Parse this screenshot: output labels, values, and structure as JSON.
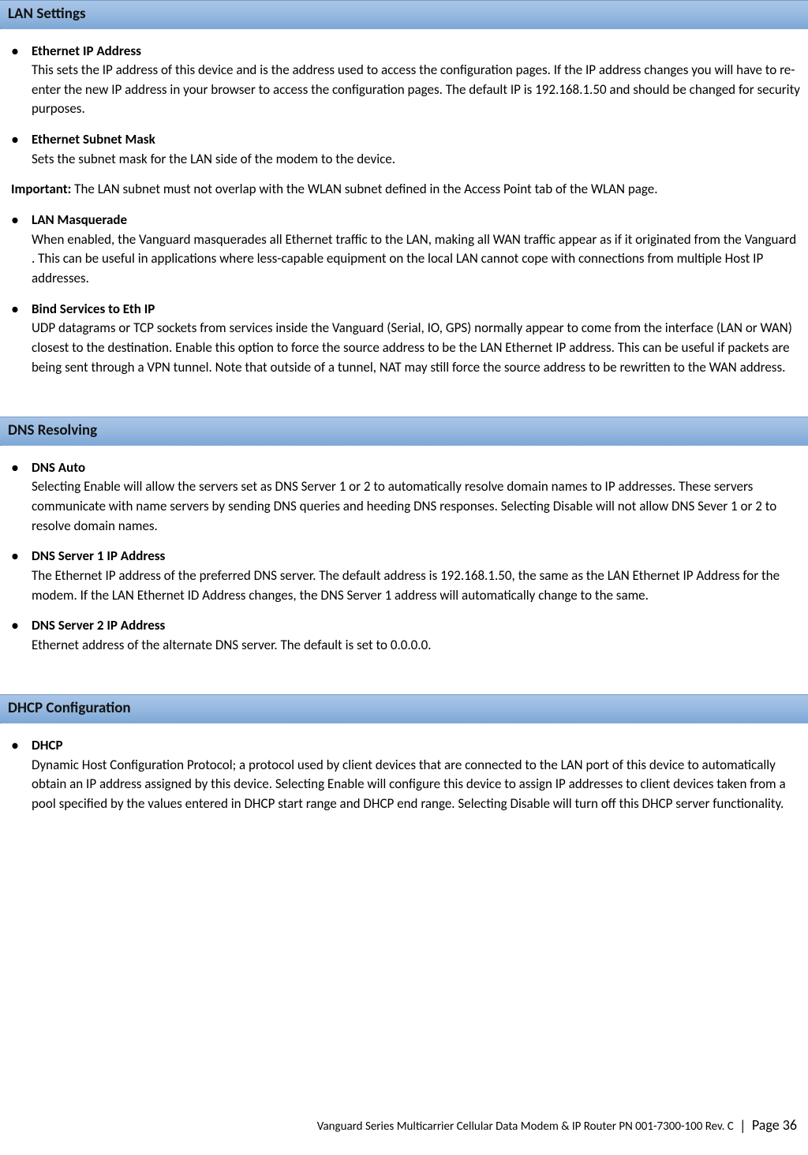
{
  "sections": [
    {
      "title": "LAN Settings",
      "items_before": [
        {
          "title": "Ethernet IP Address",
          "desc": "This sets the IP address of this device and is the address used to access the configuration pages. If the IP address changes you will have to re-enter the new IP address in your browser to access the configuration pages. The default IP is 192.168.1.50 and should be changed for security purposes."
        },
        {
          "title": "Ethernet Subnet Mask",
          "desc": "Sets the subnet mask for the LAN side of the modem to the device."
        }
      ],
      "note": {
        "label": "Important:",
        "text": " The LAN subnet must not overlap with the WLAN subnet defined in the Access Point tab of the WLAN page."
      },
      "items_after": [
        {
          "title": "LAN Masquerade",
          "desc": "When enabled, the Vanguard masquerades all Ethernet traffic to the LAN, making all WAN traffic appear as if it originated from the Vanguard . This can be useful in applications where less-capable equipment on the local LAN cannot cope with connections from multiple Host IP addresses."
        },
        {
          "title": "Bind Services to Eth IP",
          "desc": "UDP datagrams or TCP sockets from services inside the Vanguard (Serial, IO, GPS) normally appear to come from the interface (LAN or WAN) closest to the destination. Enable this option to force the source address to be the LAN Ethernet IP address. This can be useful if packets are being sent through a VPN tunnel. Note that outside of a tunnel, NAT may still force the source address to be rewritten to the WAN address."
        }
      ]
    },
    {
      "title": "DNS Resolving",
      "items_before": [
        {
          "title": "DNS Auto",
          "desc": "Selecting Enable will allow the servers set as DNS Server 1 or 2 to automatically resolve domain names to IP addresses. These servers communicate with name servers by sending DNS queries and heeding DNS responses. Selecting Disable will not allow DNS Sever 1 or 2 to resolve domain names."
        },
        {
          "title": "DNS Server 1 IP Address",
          "desc": "The Ethernet IP address of the preferred DNS server. The default address is 192.168.1.50, the same as the LAN Ethernet IP Address for the modem. If the LAN Ethernet ID Address changes, the DNS Server 1 address will automatically change to the same."
        },
        {
          "title": "DNS Server 2 IP Address",
          "desc": "Ethernet address of the alternate DNS server. The default is set to 0.0.0.0."
        }
      ]
    },
    {
      "title": "DHCP Configuration",
      "items_before": [
        {
          "title": "DHCP",
          "desc": "Dynamic Host Configuration Protocol; a protocol used by client devices that are connected to the LAN port of this device to automatically obtain an IP address assigned by this device. Selecting Enable will configure this device to assign IP addresses to client devices taken from a pool specified by the values entered in DHCP start range and DHCP end range. Selecting Disable will turn off this DHCP server functionality."
        }
      ]
    }
  ],
  "footer": {
    "product": "Vanguard Series Multicarrier Cellular Data Modem & IP Router PN 001-7300-100 Rev. C",
    "page_label": "Page 36"
  }
}
